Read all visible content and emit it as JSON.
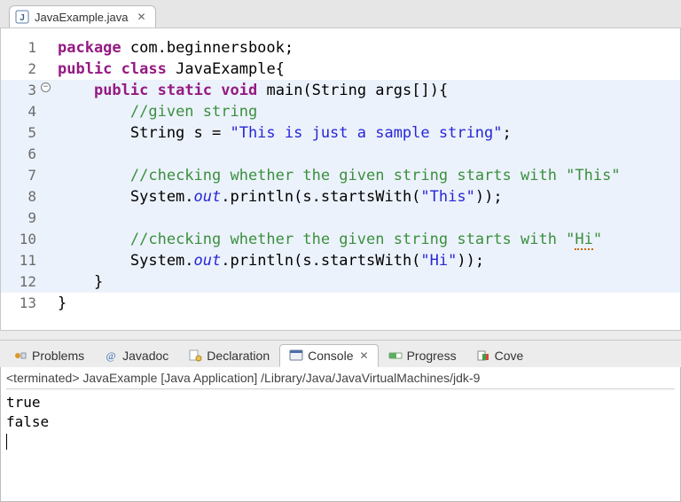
{
  "editor": {
    "tab": {
      "filename": "JavaExample.java"
    },
    "lines": [
      {
        "n": "1",
        "hl": false,
        "tokens": [
          {
            "c": "kw",
            "t": "package"
          },
          {
            "c": "pln",
            "t": " com.beginnersbook;"
          }
        ]
      },
      {
        "n": "2",
        "hl": false,
        "tokens": [
          {
            "c": "kw",
            "t": "public"
          },
          {
            "c": "pln",
            "t": " "
          },
          {
            "c": "kw",
            "t": "class"
          },
          {
            "c": "pln",
            "t": " JavaExample{"
          }
        ]
      },
      {
        "n": "3",
        "hl": true,
        "fold": true,
        "tokens": [
          {
            "c": "pln",
            "t": "    "
          },
          {
            "c": "kw",
            "t": "public"
          },
          {
            "c": "pln",
            "t": " "
          },
          {
            "c": "kw",
            "t": "static"
          },
          {
            "c": "pln",
            "t": " "
          },
          {
            "c": "kw",
            "t": "void"
          },
          {
            "c": "pln",
            "t": " main(String args[]){"
          }
        ]
      },
      {
        "n": "4",
        "hl": true,
        "tokens": [
          {
            "c": "pln",
            "t": "        "
          },
          {
            "c": "cmt",
            "t": "//given string"
          }
        ]
      },
      {
        "n": "5",
        "hl": true,
        "tokens": [
          {
            "c": "pln",
            "t": "        String s = "
          },
          {
            "c": "str",
            "t": "\"This is just a sample string\""
          },
          {
            "c": "pln",
            "t": ";"
          }
        ]
      },
      {
        "n": "6",
        "hl": true,
        "tokens": []
      },
      {
        "n": "7",
        "hl": true,
        "tokens": [
          {
            "c": "pln",
            "t": "        "
          },
          {
            "c": "cmt",
            "t": "//checking whether the given string starts with \"This\""
          }
        ]
      },
      {
        "n": "8",
        "hl": true,
        "tokens": [
          {
            "c": "pln",
            "t": "        System."
          },
          {
            "c": "stat",
            "t": "out"
          },
          {
            "c": "pln",
            "t": ".println(s.startsWith("
          },
          {
            "c": "str",
            "t": "\"This\""
          },
          {
            "c": "pln",
            "t": "));"
          }
        ]
      },
      {
        "n": "9",
        "hl": true,
        "tokens": []
      },
      {
        "n": "10",
        "hl": true,
        "tokens": [
          {
            "c": "pln",
            "t": "        "
          },
          {
            "c": "cmt",
            "t": "//checking whether the given string starts with \""
          },
          {
            "c": "cmt sq-err",
            "t": "Hi"
          },
          {
            "c": "cmt",
            "t": "\""
          }
        ]
      },
      {
        "n": "11",
        "hl": true,
        "tokens": [
          {
            "c": "pln",
            "t": "        System."
          },
          {
            "c": "stat",
            "t": "out"
          },
          {
            "c": "pln",
            "t": ".println(s.startsWith("
          },
          {
            "c": "str",
            "t": "\"Hi\""
          },
          {
            "c": "pln",
            "t": "));"
          }
        ]
      },
      {
        "n": "12",
        "hl": true,
        "tokens": [
          {
            "c": "pln",
            "t": "    }"
          }
        ]
      },
      {
        "n": "13",
        "hl": false,
        "tokens": [
          {
            "c": "pln",
            "t": "}"
          }
        ]
      }
    ]
  },
  "views": {
    "tabs": [
      {
        "id": "problems",
        "label": "Problems",
        "active": false
      },
      {
        "id": "javadoc",
        "label": "Javadoc",
        "active": false
      },
      {
        "id": "declaration",
        "label": "Declaration",
        "active": false
      },
      {
        "id": "console",
        "label": "Console",
        "active": true
      },
      {
        "id": "progress",
        "label": "Progress",
        "active": false
      },
      {
        "id": "coverage",
        "label": "Cove",
        "active": false
      }
    ]
  },
  "console": {
    "title": "<terminated> JavaExample [Java Application] /Library/Java/JavaVirtualMachines/jdk-9",
    "output": "true\nfalse\n"
  }
}
